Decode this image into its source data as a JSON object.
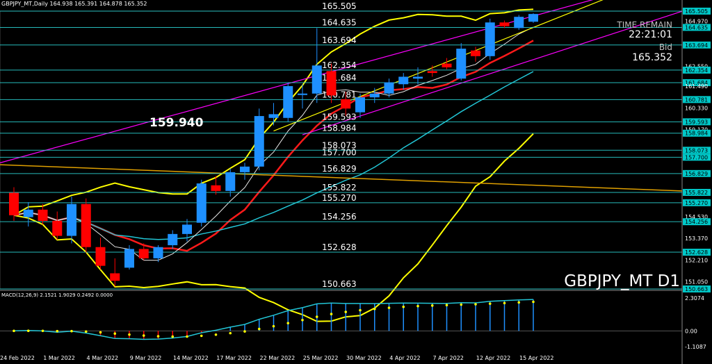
{
  "header": {
    "ohlc_title": "GBPJPY_MT,Daily  164.938 165.391 164.878 165.352"
  },
  "info_panel": {
    "time_remain_label": "TIME REMAIN",
    "time_remain_value": "22:21:01",
    "bid_label": "Bid",
    "bid_value": "165.352"
  },
  "watermark": "GBPJPY_MT D1",
  "big_price_label": "159.940",
  "colors": {
    "background": "#000000",
    "bull": "#1e90ff",
    "bear": "#ff0000",
    "level_line": "#2bd0d0",
    "bollinger": "#ffff00",
    "channel": "#ff00ff",
    "trend": "#e0a000",
    "ma_red": "#ff1a1a",
    "ma_cyan": "#22c5d5",
    "macd_line": "#22c5d5",
    "macd_signal": "#ffff00",
    "price_label_bg": "#00c8c8"
  },
  "chart_data": {
    "type": "candlestick",
    "title": "GBPJPY_MT,Daily",
    "symbol": "GBPJPY_MT",
    "timeframe": "D1",
    "last_bar": {
      "open": 164.938,
      "high": 165.391,
      "low": 164.878,
      "close": 165.352
    },
    "y_range": [
      150.5,
      166.4
    ],
    "price_axis_ticks": [
      "165.505",
      "164.970",
      "164.635",
      "163.694",
      "162.550",
      "162.354",
      "161.684",
      "161.490",
      "160.781",
      "160.330",
      "159.593",
      "159.170",
      "158.984",
      "158.073",
      "157.700",
      "156.829",
      "155.822",
      "155.270",
      "154.530",
      "154.256",
      "153.370",
      "152.628",
      "152.210",
      "151.050",
      "150.663"
    ],
    "highlighted_levels": [
      165.505,
      164.635,
      163.694,
      162.354,
      161.684,
      160.781,
      159.593,
      158.984,
      158.073,
      157.7,
      156.829,
      155.822,
      155.27,
      154.256,
      152.628,
      150.663
    ],
    "level_labels": [
      "165.505",
      "164.635",
      "163.694",
      "162.354",
      "161.684",
      "160.781",
      "159.593",
      "158.984",
      "158.073",
      "157.700",
      "156.829",
      "155.822",
      "155.270",
      "154.256",
      "152.628",
      "150.663"
    ],
    "date_labels": [
      "24 Feb 2022",
      "1 Mar 2022",
      "4 Mar 2022",
      "9 Mar 2022",
      "14 Mar 2022",
      "17 Mar 2022",
      "22 Mar 2022",
      "25 Mar 2022",
      "30 Mar 2022",
      "4 Apr 2022",
      "7 Apr 2022",
      "12 Apr 2022",
      "15 Apr 2022"
    ],
    "candles": [
      {
        "o": 155.8,
        "h": 156.1,
        "l": 154.3,
        "c": 154.6
      },
      {
        "o": 154.5,
        "h": 155.3,
        "l": 154.0,
        "c": 154.9
      },
      {
        "o": 154.9,
        "h": 155.2,
        "l": 154.1,
        "c": 154.3
      },
      {
        "o": 154.3,
        "h": 154.8,
        "l": 153.3,
        "c": 153.5
      },
      {
        "o": 153.5,
        "h": 155.6,
        "l": 153.1,
        "c": 155.2
      },
      {
        "o": 155.2,
        "h": 155.5,
        "l": 152.6,
        "c": 152.9
      },
      {
        "o": 152.9,
        "h": 153.4,
        "l": 151.7,
        "c": 151.9
      },
      {
        "o": 151.5,
        "h": 152.3,
        "l": 150.8,
        "c": 151.1
      },
      {
        "o": 151.8,
        "h": 153.0,
        "l": 151.7,
        "c": 152.8
      },
      {
        "o": 152.8,
        "h": 153.1,
        "l": 152.2,
        "c": 152.3
      },
      {
        "o": 152.3,
        "h": 153.0,
        "l": 152.1,
        "c": 152.9
      },
      {
        "o": 153.0,
        "h": 153.8,
        "l": 152.8,
        "c": 153.6
      },
      {
        "o": 153.6,
        "h": 154.4,
        "l": 153.2,
        "c": 154.1
      },
      {
        "o": 154.2,
        "h": 156.5,
        "l": 154.0,
        "c": 156.3
      },
      {
        "o": 156.2,
        "h": 156.7,
        "l": 155.7,
        "c": 155.9
      },
      {
        "o": 155.9,
        "h": 157.1,
        "l": 155.6,
        "c": 156.9
      },
      {
        "o": 156.9,
        "h": 157.4,
        "l": 156.5,
        "c": 157.2
      },
      {
        "o": 157.2,
        "h": 160.3,
        "l": 157.0,
        "c": 159.9
      },
      {
        "o": 159.8,
        "h": 160.6,
        "l": 159.4,
        "c": 160.0
      },
      {
        "o": 159.8,
        "h": 161.7,
        "l": 159.6,
        "c": 161.5
      },
      {
        "o": 161.1,
        "h": 161.6,
        "l": 160.3,
        "c": 161.1
      },
      {
        "o": 161.1,
        "h": 164.6,
        "l": 160.6,
        "c": 162.6
      },
      {
        "o": 162.3,
        "h": 162.7,
        "l": 160.6,
        "c": 161.0
      },
      {
        "o": 160.8,
        "h": 161.2,
        "l": 159.9,
        "c": 160.3
      },
      {
        "o": 160.1,
        "h": 161.1,
        "l": 159.8,
        "c": 160.9
      },
      {
        "o": 160.9,
        "h": 161.4,
        "l": 160.6,
        "c": 161.1
      },
      {
        "o": 161.1,
        "h": 161.9,
        "l": 160.9,
        "c": 161.7
      },
      {
        "o": 161.6,
        "h": 162.2,
        "l": 161.3,
        "c": 162.0
      },
      {
        "o": 161.9,
        "h": 162.5,
        "l": 161.6,
        "c": 162.0
      },
      {
        "o": 162.3,
        "h": 162.6,
        "l": 162.0,
        "c": 162.2
      },
      {
        "o": 162.7,
        "h": 163.0,
        "l": 162.4,
        "c": 162.5
      },
      {
        "o": 161.9,
        "h": 163.8,
        "l": 161.8,
        "c": 163.5
      },
      {
        "o": 163.4,
        "h": 163.6,
        "l": 162.8,
        "c": 163.1
      },
      {
        "o": 163.1,
        "h": 165.1,
        "l": 162.9,
        "c": 164.9
      },
      {
        "o": 164.9,
        "h": 165.0,
        "l": 164.6,
        "c": 164.7
      },
      {
        "o": 164.6,
        "h": 165.3,
        "l": 164.5,
        "c": 165.2
      },
      {
        "o": 164.938,
        "h": 165.391,
        "l": 164.878,
        "c": 165.352
      }
    ],
    "macd": {
      "label": "MACD(12,26,9) 2.1521 1.9029 0.2492 0.0000",
      "params": [
        12,
        26,
        9
      ],
      "main": 2.1521,
      "signal": 1.9029,
      "histogram": 0.2492,
      "y_ticks": [
        "2.3074",
        "0.00",
        "-1.1087"
      ],
      "y_range": [
        -1.25,
        2.45
      ]
    }
  }
}
